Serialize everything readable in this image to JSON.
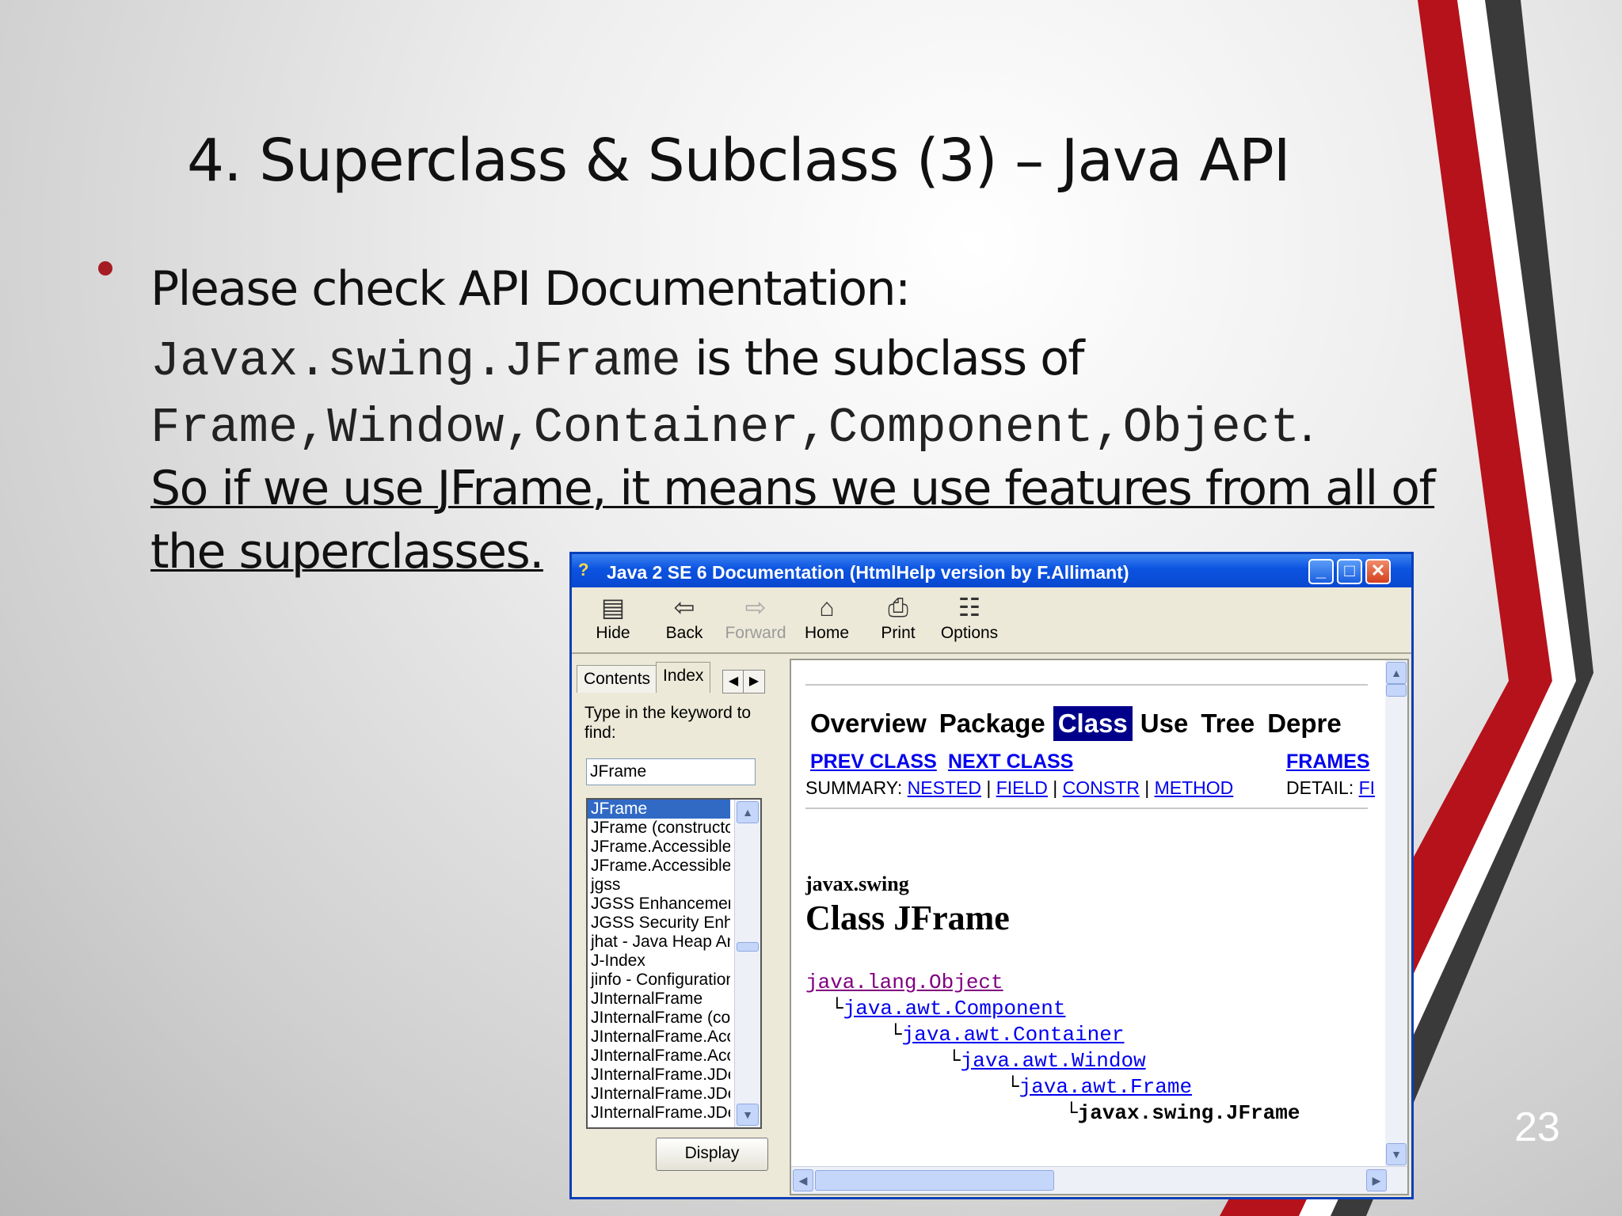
{
  "slide": {
    "title": "4. Superclass & Subclass (3) – Java API",
    "line1": "Please check API Documentation:",
    "line2_code": "Javax.swing.JFrame",
    "line2_text": " is the subclass of",
    "line3_code": "Frame,Window,Container,Component,Object",
    "line3_text": ".",
    "line4": "So if we use JFrame, it means we use features from all of",
    "line5": "the superclasses.",
    "page_number": "23",
    "colors": {
      "accent_red": "#b5121b",
      "accent_dark": "#3a3a3a"
    }
  },
  "window": {
    "title": "Java 2 SE 6 Documentation (HtmlHelp version by F.Allimant)",
    "toolbar": [
      {
        "label": "Hide",
        "icon": "hide-icon"
      },
      {
        "label": "Back",
        "icon": "back-arrow-icon"
      },
      {
        "label": "Forward",
        "icon": "forward-arrow-icon"
      },
      {
        "label": "Home",
        "icon": "home-icon"
      },
      {
        "label": "Print",
        "icon": "printer-icon"
      },
      {
        "label": "Options",
        "icon": "options-icon"
      }
    ],
    "tabs": [
      "Contents",
      "Index"
    ],
    "prompt": "Type in the keyword to find:",
    "keyword": "JFrame",
    "index_list": [
      "JFrame",
      "JFrame (constructors",
      "JFrame.AccessibleJF",
      "JFrame.AccessibleJF",
      "jgss",
      "JGSS Enhancement",
      "JGSS Security Enha",
      "jhat - Java Heap An",
      "J-Index",
      "jinfo - Configuration I",
      "JInternalFrame",
      "JInternalFrame (cons",
      "JInternalFrame.Acce",
      "JInternalFrame.Acce",
      "JInternalFrame.JDes",
      "JInternalFrame.JDes",
      "JInternalFrame.JDes"
    ],
    "display_button": "Display",
    "doc": {
      "nav": [
        "Overview",
        "Package",
        "Class",
        "Use",
        "Tree",
        "Depre"
      ],
      "prev_class": "PREV CLASS",
      "next_class": "NEXT CLASS",
      "frames": "FRAMES",
      "summary_label": "SUMMARY:",
      "summary_links": [
        "NESTED",
        "FIELD",
        "CONSTR",
        "METHOD"
      ],
      "detail_label": "DETAIL:",
      "detail_link": "FI",
      "package": "javax.swing",
      "class_title": "Class JFrame",
      "hierarchy": [
        "java.lang.Object",
        "java.awt.Component",
        "java.awt.Container",
        "java.awt.Window",
        "java.awt.Frame",
        "javax.swing.JFrame"
      ]
    }
  }
}
